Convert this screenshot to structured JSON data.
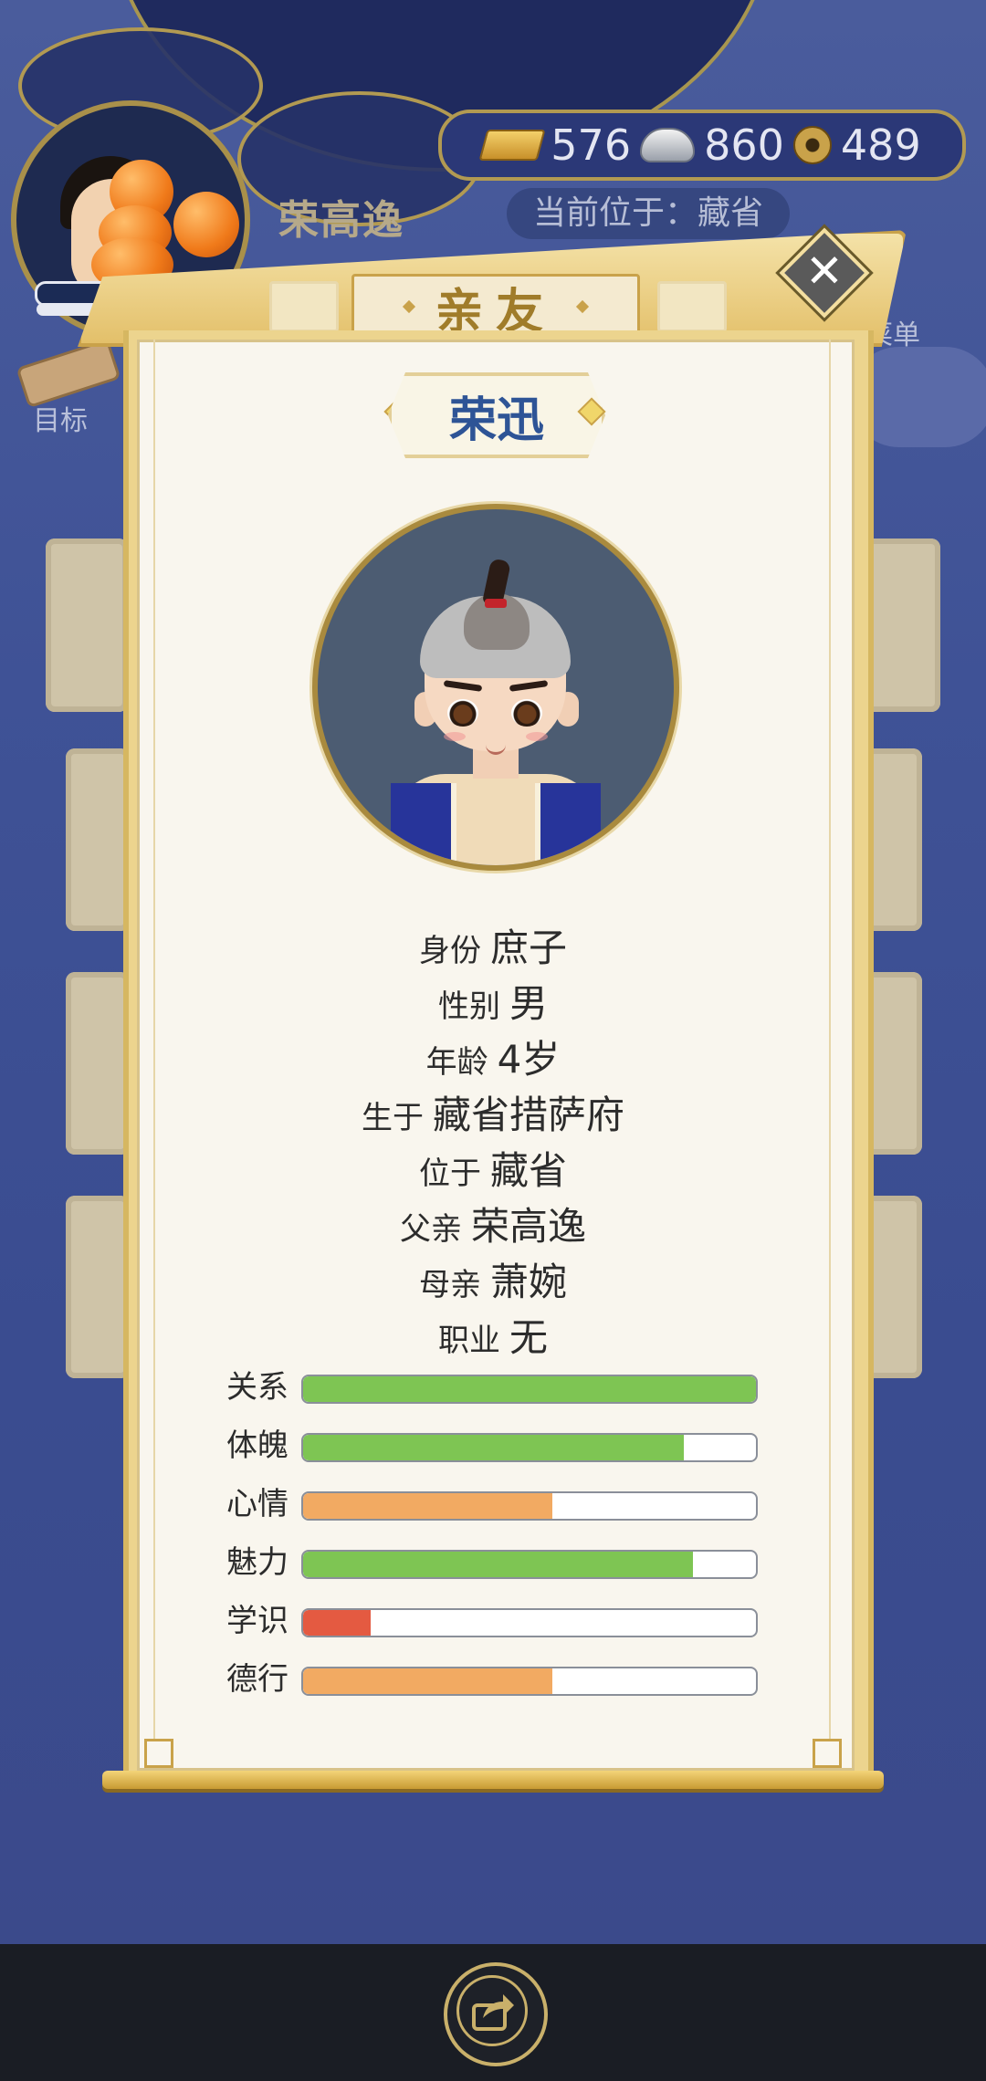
{
  "hud": {
    "player_name": "荣高逸",
    "location": "当前位于：藏省",
    "gold": "576",
    "silver": "860",
    "coins": "489",
    "menu_label": "菜单",
    "goal_label": "目标"
  },
  "modal": {
    "title": "亲友",
    "close_icon": "close-icon",
    "person": {
      "name": "荣迅",
      "info": [
        {
          "label": "身份",
          "value": "庶子"
        },
        {
          "label": "性别",
          "value": "男"
        },
        {
          "label": "年龄",
          "value": "4岁"
        },
        {
          "label": "生于",
          "value": "藏省措萨府"
        },
        {
          "label": "位于",
          "value": "藏省"
        },
        {
          "label": "父亲",
          "value": "荣高逸"
        },
        {
          "label": "母亲",
          "value": "萧婉"
        },
        {
          "label": "职业",
          "value": "无"
        }
      ],
      "stats": [
        {
          "label": "关系",
          "fraction": 1.0,
          "color": "#7ec553"
        },
        {
          "label": "体魄",
          "fraction": 0.84,
          "color": "#7ec553"
        },
        {
          "label": "心情",
          "fraction": 0.55,
          "color": "#f2aa62"
        },
        {
          "label": "魅力",
          "fraction": 0.86,
          "color": "#7ec553"
        },
        {
          "label": "学识",
          "fraction": 0.15,
          "color": "#e45a41"
        },
        {
          "label": "德行",
          "fraction": 0.55,
          "color": "#f2aa62"
        }
      ]
    }
  },
  "bottom_nav": {
    "share_icon": "share-icon"
  }
}
